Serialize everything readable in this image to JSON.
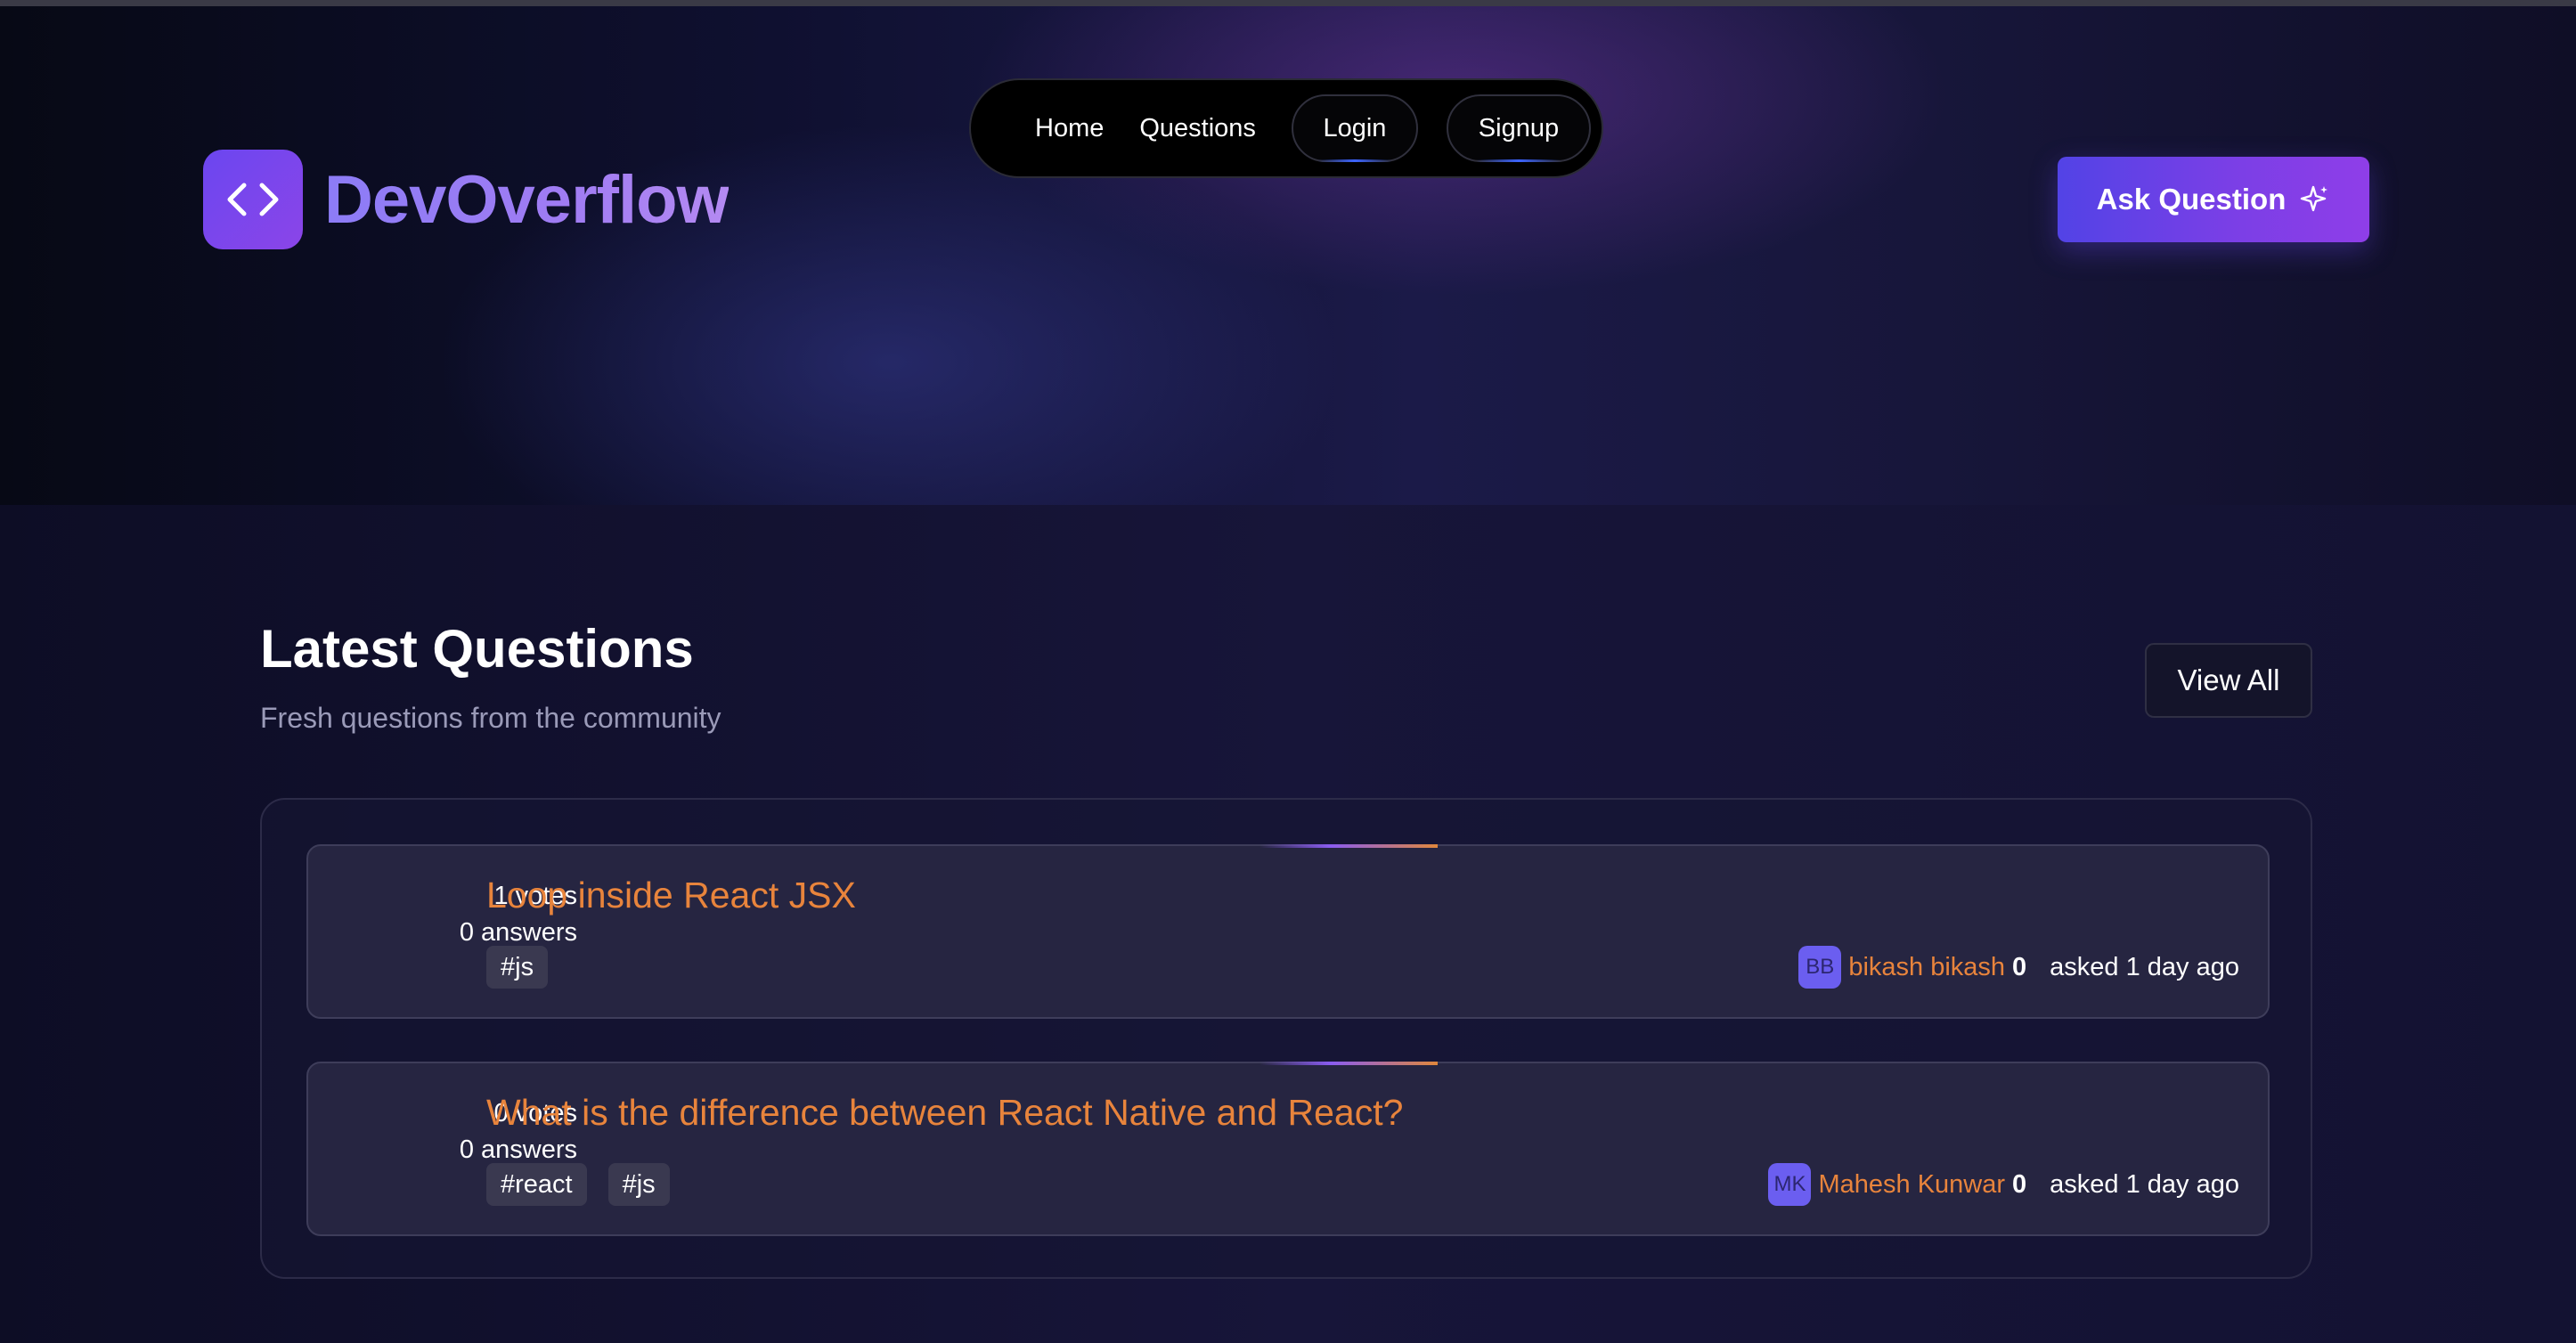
{
  "brand": {
    "name": "DevOverflow",
    "icon": "code-brackets-icon"
  },
  "nav": {
    "home": "Home",
    "questions": "Questions",
    "login": "Login",
    "signup": "Signup"
  },
  "ask_button": {
    "label": "Ask Question",
    "icon": "sparkles-icon"
  },
  "latest": {
    "title": "Latest Questions",
    "subtitle": "Fresh questions from the community",
    "view_all": "View All"
  },
  "questions": [
    {
      "votes": "1 votes",
      "answers": "0 answers",
      "title": "Loop inside React JSX",
      "tags": [
        "#js"
      ],
      "author_initials": "BB",
      "author": "bikash bikash",
      "reputation": "0",
      "asked": "asked 1 day ago"
    },
    {
      "votes": "0 votes",
      "answers": "0 answers",
      "title": "What is the difference between React Native and React?",
      "tags": [
        "#react",
        "#js"
      ],
      "author_initials": "MK",
      "author": "Mahesh Kunwar",
      "reputation": "0",
      "asked": "asked 1 day ago"
    }
  ],
  "colors": {
    "accent": "#7a3fe6",
    "link_orange": "#e8843c",
    "background": "#14122e"
  }
}
